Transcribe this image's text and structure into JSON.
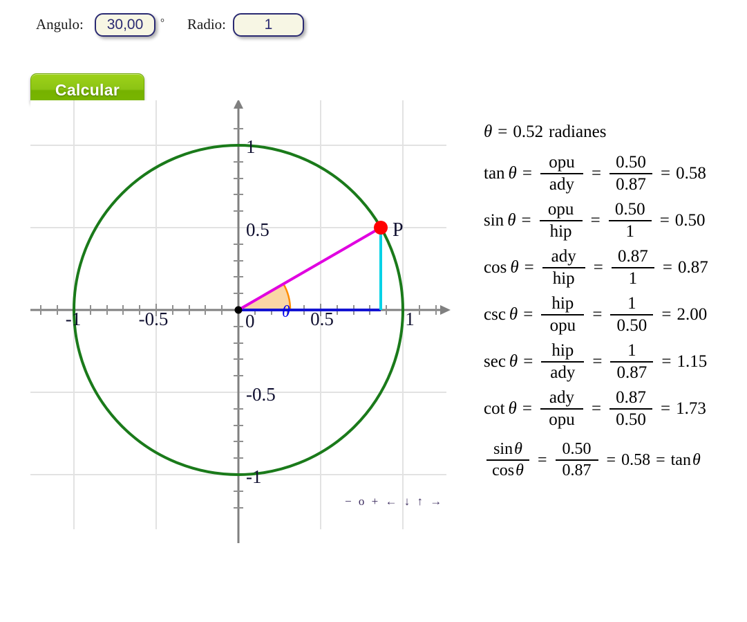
{
  "controls": {
    "angulo_label": "Angulo:",
    "angulo_value": "30,00",
    "degree_symbol": "°",
    "radio_label": "Radio:",
    "radio_value": "1",
    "calcular_label": "Calcular"
  },
  "colors": {
    "circle": "#1a7a1a",
    "hypotenuse": "#e000e0",
    "adjacent": "#1414d2",
    "opposite": "#00d2e6",
    "point": "#ff0000",
    "angle_arc_fill": "#fad6a5",
    "angle_arc_stroke": "#ff8c00",
    "axis": "#808080",
    "grid": "#e0e0e0",
    "button": "#8cc414",
    "field_bg": "#f7f6e4",
    "field_border": "#2a2a72"
  },
  "chart_data": {
    "type": "scatter",
    "title": "",
    "xlabel": "",
    "ylabel": "",
    "xlim": [
      -1.28,
      1.28
    ],
    "ylim": [
      -1.28,
      1.28
    ],
    "grid": true,
    "legend": "none",
    "x_ticks": [
      "-1",
      "-0.5",
      "0",
      "0.5",
      "1"
    ],
    "x_tick_values": [
      -1,
      -0.5,
      0,
      0.5,
      1
    ],
    "y_ticks": [
      "-1",
      "-0.5",
      "0.5",
      "1"
    ],
    "y_tick_values": [
      -1,
      -0.5,
      0.5,
      1
    ],
    "unit_circle": {
      "center": [
        0,
        0
      ],
      "radius": 1
    },
    "angle_degrees": 30,
    "angle_radians": 0.52,
    "point_label": "P",
    "point": [
      0.87,
      0.5
    ],
    "segments": [
      {
        "name": "hipotenusa",
        "from": [
          0,
          0
        ],
        "to": [
          0.87,
          0.5
        ]
      },
      {
        "name": "adyacente",
        "from": [
          0,
          0
        ],
        "to": [
          0.87,
          0
        ]
      },
      {
        "name": "opuesto",
        "from": [
          0.87,
          0
        ],
        "to": [
          0.87,
          0.5
        ]
      }
    ],
    "angle_label": "θ"
  },
  "navbar": {
    "items": [
      "−",
      "o",
      "+",
      "←",
      "↓",
      "↑",
      "→"
    ],
    "text": "− o + ← ↓ ↑ →"
  },
  "math": {
    "radians_line": {
      "theta": "θ",
      "eq": "=",
      "value": "0.52",
      "unit": "radianes"
    },
    "rows": [
      {
        "fn": "tan",
        "num": "opu",
        "den": "ady",
        "num2": "0.50",
        "den2": "0.87",
        "result": "0.58"
      },
      {
        "fn": "sin",
        "num": "opu",
        "den": "hip",
        "num2": "0.50",
        "den2": "1",
        "result": "0.50"
      },
      {
        "fn": "cos",
        "num": "ady",
        "den": "hip",
        "num2": "0.87",
        "den2": "1",
        "result": "0.87"
      },
      {
        "fn": "csc",
        "num": "hip",
        "den": "opu",
        "num2": "1",
        "den2": "0.50",
        "result": "2.00"
      },
      {
        "fn": "sec",
        "num": "hip",
        "den": "ady",
        "num2": "1",
        "den2": "0.87",
        "result": "1.15"
      },
      {
        "fn": "cot",
        "num": "ady",
        "den": "opu",
        "num2": "0.87",
        "den2": "0.50",
        "result": "1.73"
      }
    ],
    "identity": {
      "num": "sin",
      "den": "cos",
      "theta": "θ",
      "num2": "0.50",
      "den2": "0.87",
      "result": "0.58",
      "equals_fn": "tan"
    },
    "symbols": {
      "equals": "=",
      "theta": "θ"
    }
  }
}
